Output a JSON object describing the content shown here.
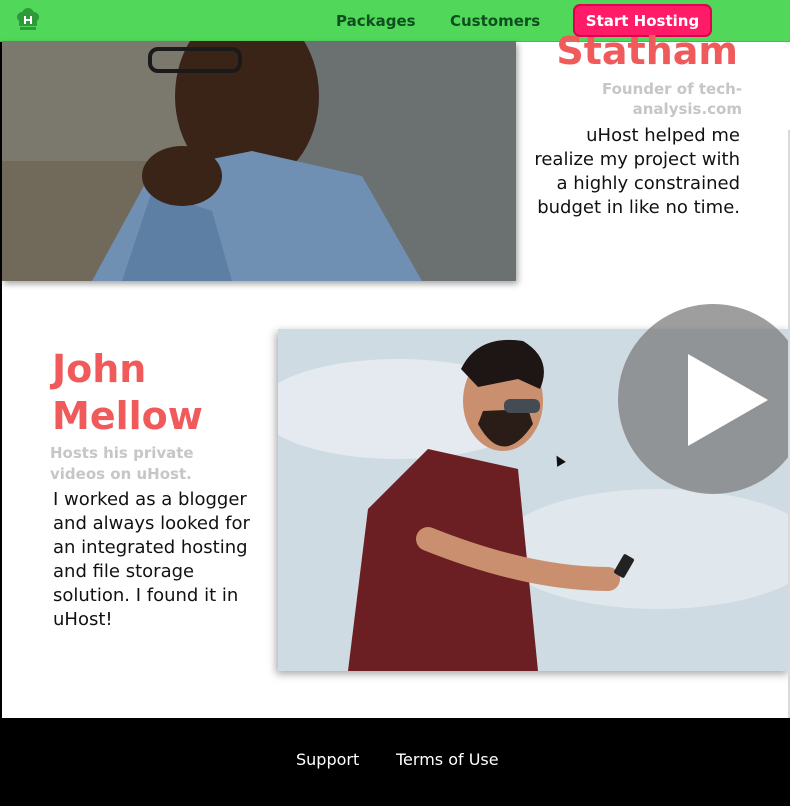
{
  "header": {
    "logo_icon": "uhost-logo-icon",
    "nav": [
      {
        "label": "Packages"
      },
      {
        "label": "Customers"
      }
    ],
    "cta_label": "Start Hosting",
    "colors": {
      "bar": "#51d85a",
      "cta": "#ff1b68",
      "nav_text": "#0e4f1f"
    }
  },
  "customers": [
    {
      "name": "Statham",
      "role": "Founder of tech-analysis.com",
      "quote": "uHost helped me realize my project with a highly constrained budget in like no time."
    },
    {
      "name_line1": "John",
      "name_line2": "Mellow",
      "role": "Hosts his private videos on uHost.",
      "quote": "I worked as a blogger and always looked for an integrated hosting and file storage solution. I found it in uHost!"
    }
  ],
  "video": {
    "play_icon": "play-icon"
  },
  "footer": {
    "links": [
      {
        "label": "Support"
      },
      {
        "label": "Terms of Use"
      }
    ]
  },
  "colors": {
    "name": "#f05a5a",
    "role": "#c6c6c6",
    "footer": "#000000"
  }
}
